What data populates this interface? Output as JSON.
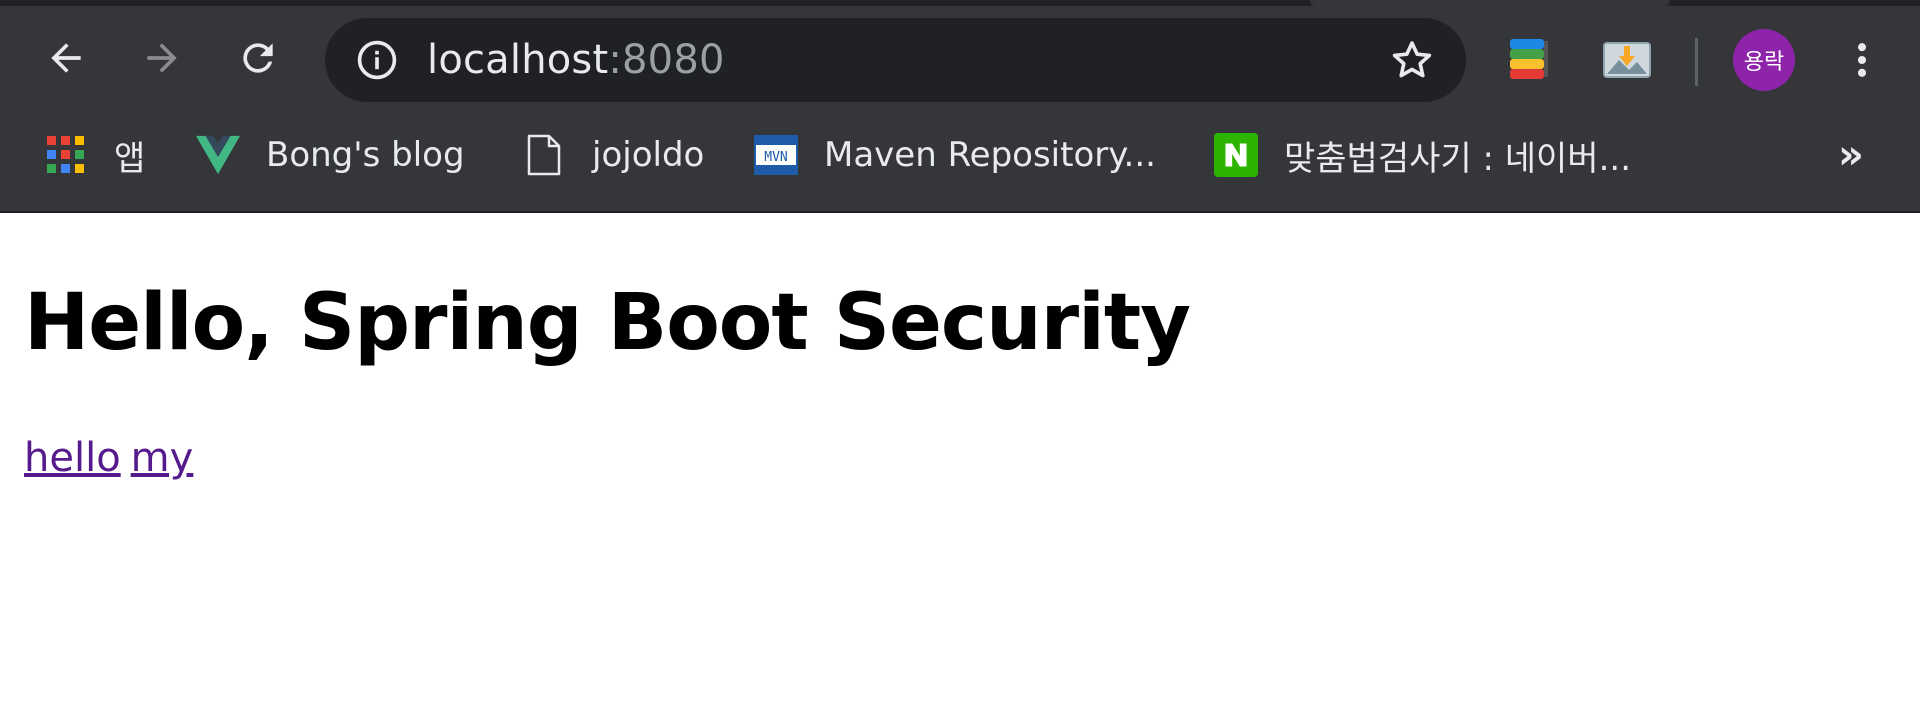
{
  "browser": {
    "url_host": "localhost",
    "url_port": ":8080",
    "profile_initials": "용락",
    "bookmarks": [
      {
        "label": "앱",
        "icon": "apps-grid-icon"
      },
      {
        "label": "Bong's blog",
        "icon": "vue-logo-icon"
      },
      {
        "label": "jojoldo",
        "icon": "page-icon"
      },
      {
        "label": "Maven Repository...",
        "icon": "maven-icon"
      },
      {
        "label": "맞춤법검사기 : 네이버...",
        "icon": "naver-icon"
      }
    ],
    "bookmarks_overflow": "»",
    "colors": {
      "toolbar": "#35363a",
      "omnibox": "#202124",
      "avatar": "#8e24aa"
    }
  },
  "page": {
    "heading": "Hello, Spring Boot Security",
    "links": [
      {
        "label": "hello"
      },
      {
        "label": "my"
      }
    ],
    "link_color": "#551a8b"
  }
}
